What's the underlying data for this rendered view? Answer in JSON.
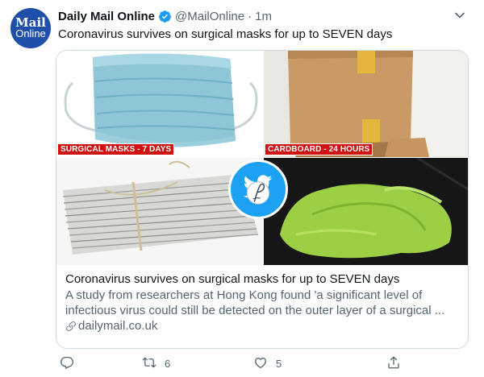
{
  "tweet": {
    "avatar": {
      "line1": "Mail",
      "line2": "Online"
    },
    "display_name": "Daily Mail Online",
    "handle": "@MailOnline",
    "separator": "·",
    "time": "1m",
    "text": "Coronavirus survives on surgical masks for up to SEVEN days"
  },
  "card": {
    "labels": {
      "masks": "SURGICAL MASKS - 7 DAYS",
      "cardboard": "CARDBOARD - 24 HOURS"
    },
    "title": "Coronavirus survives on surgical masks for up to SEVEN days",
    "description_line1": "A study from researchers at Hong Kong found 'a significant level of",
    "description_line2": "infectious virus could still be detected on the outer layer of a surgical ...",
    "domain": "dailymail.co.uk"
  },
  "actions": {
    "reply_count": "",
    "retweet_count": "6",
    "like_count": "5"
  },
  "colors": {
    "accent": "#1da1f2",
    "text": "#0f1419",
    "secondary": "#536471",
    "tag_red": "#cf1111",
    "avatar_blue": "#1f4fa8"
  },
  "icons": [
    "verified-badge-icon",
    "caret-down-icon",
    "twitter-bird-icon",
    "link-icon",
    "reply-icon",
    "retweet-icon",
    "like-icon",
    "share-icon"
  ]
}
